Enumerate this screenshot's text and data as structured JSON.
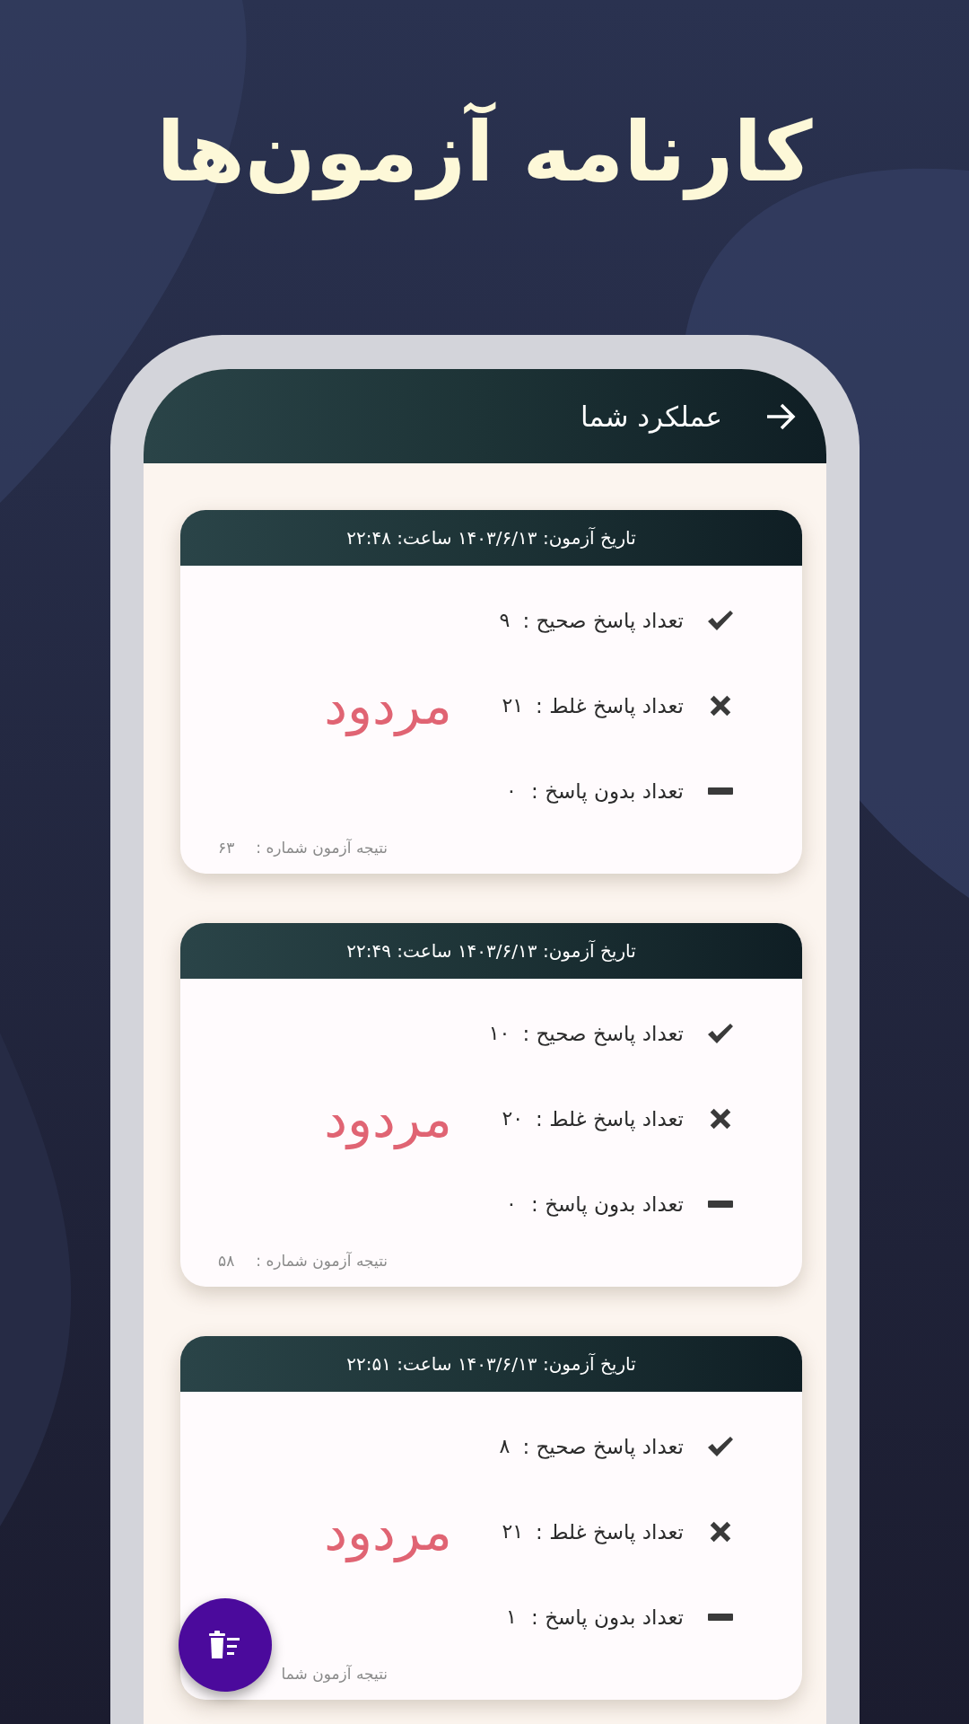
{
  "headline": "کارنامه آزمون‌ها",
  "app_bar": {
    "title": "عملکرد شما"
  },
  "results": [
    {
      "date_line": "تاریخ آزمون: ۱۴۰۳/۶/۱۳ ساعت: ۲۲:۴۸",
      "status": "مردود",
      "footer_label": "نتیجه آزمون شماره :",
      "footer_number": "۶۳",
      "rows": [
        {
          "kind": "correct",
          "label": "تعداد پاسخ صحیح :",
          "value": "۹"
        },
        {
          "kind": "wrong",
          "label": "تعداد پاسخ غلط :",
          "value": "۲۱"
        },
        {
          "kind": "blank",
          "label": "تعداد بدون پاسخ :",
          "value": "۰"
        }
      ]
    },
    {
      "date_line": "تاریخ آزمون: ۱۴۰۳/۶/۱۳ ساعت: ۲۲:۴۹",
      "status": "مردود",
      "footer_label": "نتیجه آزمون شماره :",
      "footer_number": "۵۸",
      "rows": [
        {
          "kind": "correct",
          "label": "تعداد پاسخ صحیح :",
          "value": "۱۰"
        },
        {
          "kind": "wrong",
          "label": "تعداد پاسخ غلط :",
          "value": "۲۰"
        },
        {
          "kind": "blank",
          "label": "تعداد بدون پاسخ :",
          "value": "۰"
        }
      ]
    },
    {
      "date_line": "تاریخ آزمون: ۱۴۰۳/۶/۱۳ ساعت: ۲۲:۵۱",
      "status": "مردود",
      "footer_label": "نتیجه آزمون شما",
      "rows": [
        {
          "kind": "correct",
          "label": "تعداد پاسخ صحیح :",
          "value": "۸"
        },
        {
          "kind": "wrong",
          "label": "تعداد پاسخ غلط :",
          "value": "۲۱"
        },
        {
          "kind": "blank",
          "label": "تعداد بدون پاسخ :",
          "value": "۱"
        }
      ]
    }
  ]
}
